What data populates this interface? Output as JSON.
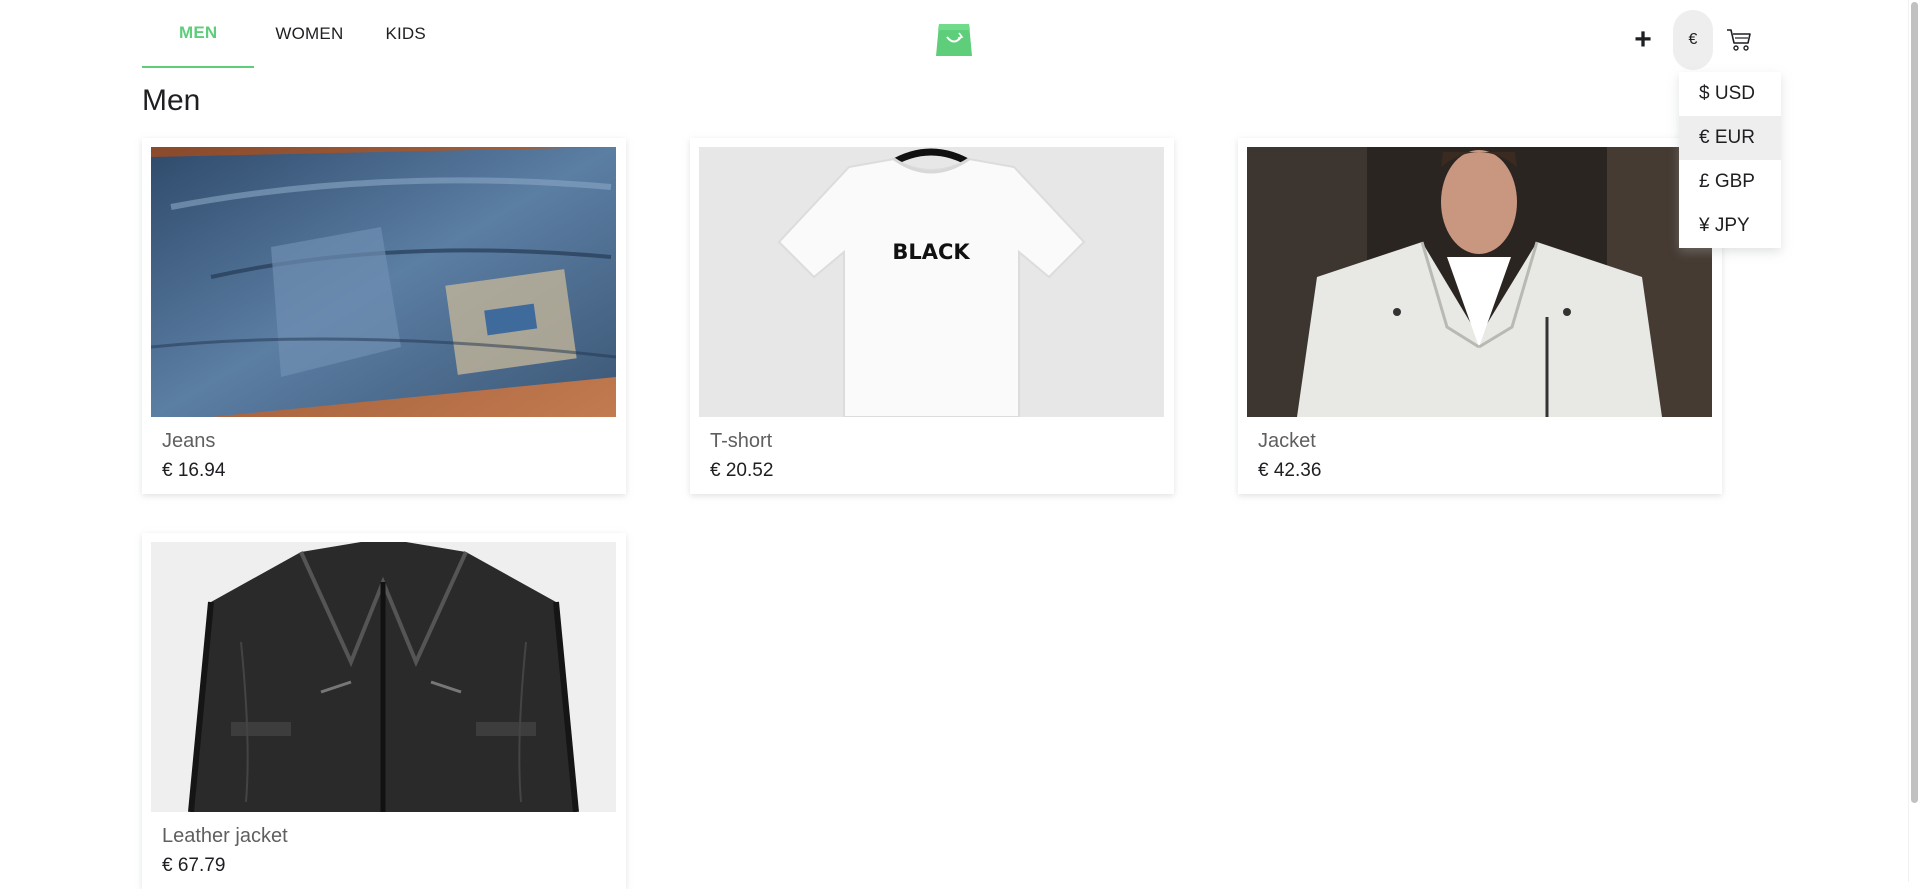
{
  "nav": {
    "tabs": [
      {
        "label": "MEN",
        "active": true
      },
      {
        "label": "WOMEN",
        "active": false
      },
      {
        "label": "KIDS",
        "active": false
      }
    ],
    "logo_icon": "shopping-bag-logo",
    "add_label": "+",
    "currency_symbol": "€",
    "cart_icon": "cart-icon"
  },
  "currency_menu": {
    "options": [
      "$ USD",
      "€ EUR",
      "£ GBP",
      "¥ JPY"
    ],
    "selected": "€ EUR"
  },
  "page": {
    "title": "Men"
  },
  "products": [
    {
      "name": "Jeans",
      "price": "€ 16.94"
    },
    {
      "name": "T-short",
      "price": "€ 20.52"
    },
    {
      "name": "Jacket",
      "price": "€ 42.36"
    },
    {
      "name": "Leather jacket",
      "price": "€ 67.79"
    }
  ],
  "colors": {
    "accent": "#5ece7b",
    "text": "#1d1f22",
    "muted": "#5f5f5f",
    "highlight": "#eeeeee"
  }
}
